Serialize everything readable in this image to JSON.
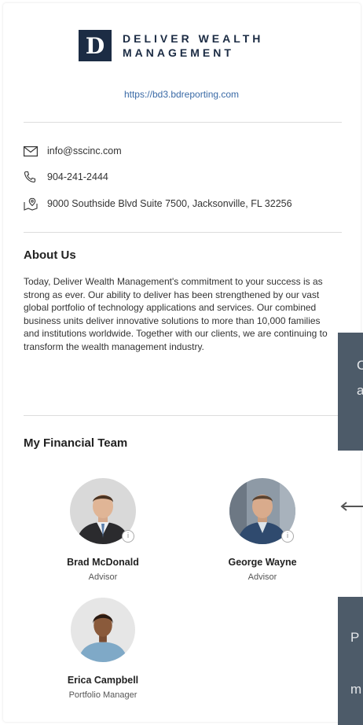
{
  "brand": {
    "logo_letter": "D",
    "line1": "DELIVER WEALTH",
    "line2": "MANAGEMENT",
    "color": "#1c2c44"
  },
  "website": "https://bd3.bdreporting.com",
  "contact": {
    "email": "info@sscinc.com",
    "phone": "904-241-2444",
    "address": "9000 Southside Blvd Suite 7500, Jacksonville, FL 32256"
  },
  "about": {
    "title": "About Us",
    "body": "Today, Deliver Wealth Management's commitment to your success is as strong as ever. Our ability to deliver has been strengthened by our vast global portfolio of technology applications and services. Our combined business units deliver innovative solutions to more than 10,000 families and institutions worldwide. Together with our clients, we are continuing to transform the wealth management industry."
  },
  "team": {
    "title": "My Financial Team",
    "members": [
      {
        "name": "Brad McDonald",
        "role": "Advisor"
      },
      {
        "name": "George Wayne",
        "role": "Advisor"
      },
      {
        "name": "Erica Campbell",
        "role": "Portfolio Manager"
      }
    ]
  },
  "overlays": {
    "top_line1": "C",
    "top_line2": "a",
    "bottom_line1": "P",
    "bottom_line2": "m"
  }
}
